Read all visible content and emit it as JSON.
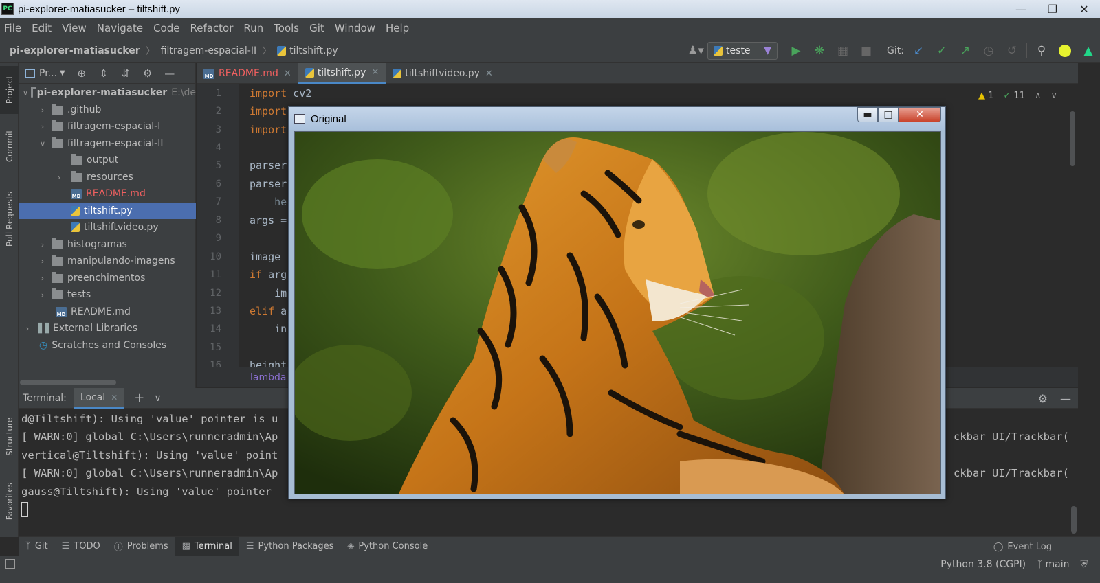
{
  "window": {
    "title": "pi-explorer-matiasucker – tiltshift.py",
    "app_icon": "PC"
  },
  "menu": [
    "File",
    "Edit",
    "View",
    "Navigate",
    "Code",
    "Refactor",
    "Run",
    "Tools",
    "Git",
    "Window",
    "Help"
  ],
  "nav": {
    "project": "pi-explorer-matiasucker",
    "folder": "filtragem-espacial-II",
    "file": "tiltshift.py",
    "run_config": "teste",
    "git_label": "Git:"
  },
  "side_tabs": {
    "project": "Project",
    "commit": "Commit",
    "pull_requests": "Pull Requests",
    "structure": "Structure",
    "favorites": "Favorites"
  },
  "project_panel": {
    "toolbar_label": "Pr...",
    "tree": [
      {
        "label": "pi-explorer-matiasucker",
        "suffix": "E:\\de",
        "level": 0,
        "type": "folder",
        "expanded": true
      },
      {
        "label": ".github",
        "level": 1,
        "type": "folder",
        "expanded": false
      },
      {
        "label": "filtragem-espacial-I",
        "level": 1,
        "type": "folder",
        "expanded": false
      },
      {
        "label": "filtragem-espacial-II",
        "level": 1,
        "type": "folder",
        "expanded": true
      },
      {
        "label": "output",
        "level": 2,
        "type": "folder",
        "leaf": true
      },
      {
        "label": "resources",
        "level": 2,
        "type": "folder",
        "expanded": false
      },
      {
        "label": "README.md",
        "level": 2,
        "type": "md",
        "modified": true
      },
      {
        "label": "tiltshift.py",
        "level": 2,
        "type": "py",
        "selected": true
      },
      {
        "label": "tiltshiftvideo.py",
        "level": 2,
        "type": "py"
      },
      {
        "label": "histogramas",
        "level": 1,
        "type": "folder",
        "expanded": false
      },
      {
        "label": "manipulando-imagens",
        "level": 1,
        "type": "folder",
        "expanded": false
      },
      {
        "label": "preenchimentos",
        "level": 1,
        "type": "folder",
        "expanded": false
      },
      {
        "label": "tests",
        "level": 1,
        "type": "folder",
        "expanded": false
      },
      {
        "label": "README.md",
        "level": 1,
        "type": "md"
      },
      {
        "label": "External Libraries",
        "level": 0,
        "type": "lib",
        "expanded": false
      },
      {
        "label": "Scratches and Consoles",
        "level": 0,
        "type": "scratch"
      }
    ]
  },
  "tabs": [
    {
      "label": "README.md",
      "modified": true
    },
    {
      "label": "tiltshift.py",
      "active": true
    },
    {
      "label": "tiltshiftvideo.py"
    }
  ],
  "editor": {
    "line_numbers": [
      "1",
      "2",
      "3",
      "4",
      "5",
      "6",
      "7",
      "8",
      "9",
      "10",
      "11",
      "12",
      "13",
      "14",
      "15",
      "16"
    ],
    "lines": [
      {
        "kw": "import",
        "rest": " cv2"
      },
      {
        "kw": "import",
        "rest": ""
      },
      {
        "kw": "import",
        "rest": ""
      },
      {
        "kw": "",
        "rest": ""
      },
      {
        "kw": "",
        "rest": "parser"
      },
      {
        "kw": "",
        "rest": "parser"
      },
      {
        "kw": "",
        "rest": "    he"
      },
      {
        "kw": "",
        "rest": "args ="
      },
      {
        "kw": "",
        "rest": ""
      },
      {
        "kw": "",
        "rest": "image "
      },
      {
        "kw": "if",
        "rest": " arg"
      },
      {
        "kw": "",
        "rest": "    im"
      },
      {
        "kw": "elif",
        "rest": " a"
      },
      {
        "kw": "",
        "rest": "    in"
      },
      {
        "kw": "",
        "rest": ""
      },
      {
        "kw": "",
        "rest": "height"
      }
    ],
    "warnings": "1",
    "checks": "11",
    "breadcrumb": "lambda"
  },
  "terminal": {
    "title": "Terminal:",
    "tab": "Local",
    "lines": [
      "d@Tiltshift): Using 'value' pointer is u",
      "[ WARN:0] global C:\\Users\\runneradmin\\Ap",
      "vertical@Tiltshift): Using 'value' point",
      "[ WARN:0] global C:\\Users\\runneradmin\\Ap",
      "gauss@Tiltshift): Using 'value' pointer "
    ],
    "right_fragments": [
      "ckbar UI/Trackbar(",
      "ckbar UI/Trackbar("
    ]
  },
  "bottom_tools": [
    "Git",
    "TODO",
    "Problems",
    "Terminal",
    "Python Packages",
    "Python Console"
  ],
  "event_log": "Event Log",
  "status": {
    "interpreter": "Python 3.8 (CGPI)",
    "branch": "main"
  },
  "cv_window": {
    "title": "Original"
  },
  "colors": {
    "accent": "#4a88c7",
    "selection": "#4b6eaf",
    "keyword": "#cc7832",
    "modified": "#ef6060",
    "run_green": "#49a35b"
  }
}
